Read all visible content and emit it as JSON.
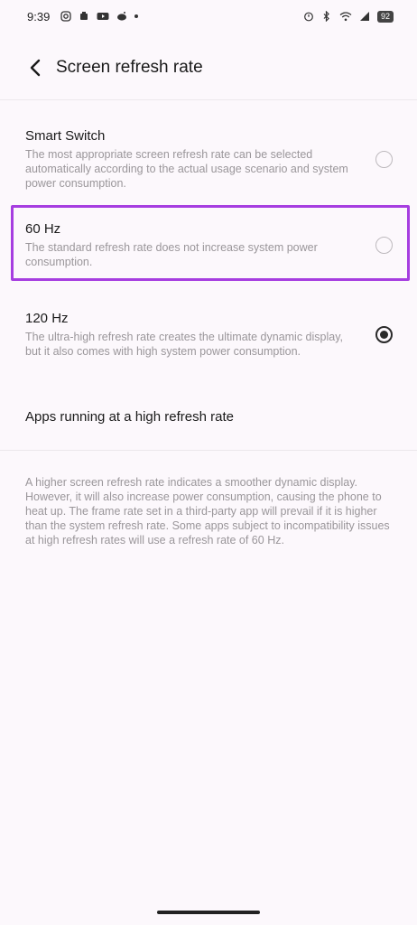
{
  "status_bar": {
    "time": "9:39",
    "battery": "92",
    "left_icons": [
      "instagram-icon",
      "notification-icon",
      "youtube-icon",
      "reddit-icon",
      "more-dot-icon"
    ],
    "right_icons": [
      "alarm-icon",
      "bluetooth-icon",
      "wifi-icon",
      "signal-icon",
      "battery-icon"
    ]
  },
  "header": {
    "title": "Screen refresh rate",
    "back_icon": "chevron-left-icon"
  },
  "options": [
    {
      "title": "Smart Switch",
      "description": "The most appropriate screen refresh rate can be selected automatically according to the actual usage scenario and system power consumption.",
      "selected": false
    },
    {
      "title": "60 Hz",
      "description": "The standard refresh rate does not increase system power consumption.",
      "selected": false
    },
    {
      "title": "120 Hz",
      "description": "The ultra-high refresh rate creates the ultimate dynamic display, but it also comes with high system power consumption.",
      "selected": true
    }
  ],
  "apps_link": {
    "label": "Apps running at a high refresh rate"
  },
  "footer_note": "A higher screen refresh rate indicates a smoother dynamic display. However, it will also increase power consumption, causing the phone to heat up. The frame rate set in a third-party app will prevail if it is higher than the system refresh rate. Some apps subject to incompatibility issues at high refresh rates will use a refresh rate of 60 Hz.",
  "colors": {
    "highlight": "#a63ee0",
    "background": "#fcf8fc",
    "secondary_text": "#9a969a"
  }
}
